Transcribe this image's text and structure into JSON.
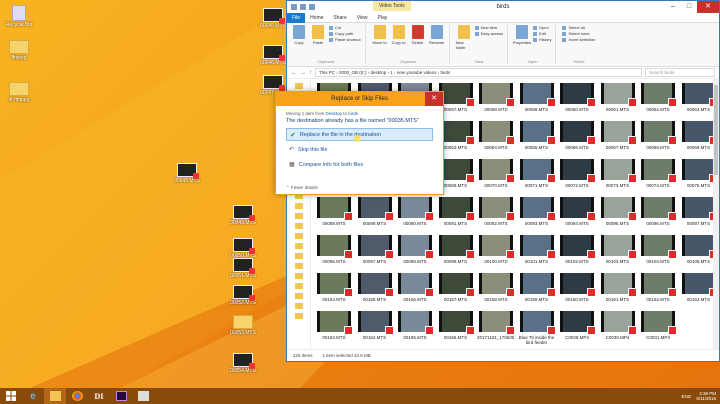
{
  "desktop": {
    "icons": [
      {
        "label": "Recycle Bin",
        "kind": "bin"
      },
      {
        "label": "ffmpeg",
        "kind": "folder"
      },
      {
        "label": "dl-ffmpeg",
        "kind": "app"
      },
      {
        "label": "00045.MTS",
        "kind": "video"
      },
      {
        "label": "00046.MTS",
        "kind": "video"
      },
      {
        "label": "00047.MTS",
        "kind": "video"
      },
      {
        "label": "00048.MTS",
        "kind": "video"
      },
      {
        "label": "00049.MTS",
        "kind": "video"
      },
      {
        "label": "00050.MTS",
        "kind": "video"
      },
      {
        "label": "00051.MTS",
        "kind": "video"
      },
      {
        "label": "00052.MTS",
        "kind": "video"
      },
      {
        "label": "00053.MTS",
        "kind": "folder"
      },
      {
        "label": "00054.MTS",
        "kind": "video"
      }
    ]
  },
  "explorer": {
    "title": "birds",
    "context_tab": "Video Tools",
    "tabs": [
      "File",
      "Home",
      "Share",
      "View",
      "Play"
    ],
    "window_controls": {
      "minimize": "–",
      "maximize": "□",
      "close": "✕"
    },
    "ribbon": {
      "clipboard": {
        "label": "Clipboard",
        "copy": "Copy",
        "paste": "Paste",
        "cut": "Cut",
        "copy_path": "Copy path",
        "paste_shortcut": "Paste shortcut"
      },
      "organize": {
        "label": "Organize",
        "move_to": "Move to",
        "copy_to": "Copy to",
        "delete": "Delete",
        "rename": "Rename"
      },
      "new": {
        "label": "New",
        "new_folder": "New folder",
        "new_item": "New item",
        "easy_access": "Easy access"
      },
      "open": {
        "label": "Open",
        "properties": "Properties",
        "open": "Open",
        "edit": "Edit",
        "history": "History"
      },
      "select": {
        "label": "Select",
        "select_all": "Select all",
        "select_none": "Select none",
        "invert": "Invert selection"
      }
    },
    "address": "This PC  ›  2000_GB (E:)  ›  desktop  ›  1  ›  new youtube videos  ›  birds",
    "search_placeholder": "Search birds",
    "status": {
      "count": "225 items",
      "selection": "1 item selected  32.6 MB"
    },
    "files": [
      {
        "name": "00054.MTS"
      },
      {
        "name": "00055.MTS"
      },
      {
        "name": "00056.MTS"
      },
      {
        "name": "00057.MTS"
      },
      {
        "name": "00058.MTS"
      },
      {
        "name": "00059.MTS"
      },
      {
        "name": "00060.MTS"
      },
      {
        "name": "00061.MTS"
      },
      {
        "name": "00062.MTS"
      },
      {
        "name": "00063.MTS"
      },
      {
        "name": "00060.MTS"
      },
      {
        "name": "00061.MTS"
      },
      {
        "name": "00062.MTS"
      },
      {
        "name": "00063.MTS"
      },
      {
        "name": "00064.MTS"
      },
      {
        "name": "00065.MTS"
      },
      {
        "name": "00066.MTS"
      },
      {
        "name": "00067.MTS"
      },
      {
        "name": "00068.MTS"
      },
      {
        "name": "00069.MTS"
      },
      {
        "name": "00066.MTS"
      },
      {
        "name": "00067.MTS"
      },
      {
        "name": "00068.MTS"
      },
      {
        "name": "00069.MTS"
      },
      {
        "name": "00070.MTS"
      },
      {
        "name": "00071.MTS"
      },
      {
        "name": "00072.MTS"
      },
      {
        "name": "00073.MTS"
      },
      {
        "name": "00074.MTS"
      },
      {
        "name": "00075.MTS"
      },
      {
        "name": "00088.MTS"
      },
      {
        "name": "00089.MTS"
      },
      {
        "name": "00090.MTS"
      },
      {
        "name": "00091.MTS"
      },
      {
        "name": "00092.MTS"
      },
      {
        "name": "00093.MTS"
      },
      {
        "name": "00094.MTS"
      },
      {
        "name": "00095.MTS"
      },
      {
        "name": "00096.MTS"
      },
      {
        "name": "00097.MTS"
      },
      {
        "name": "00096.MTS"
      },
      {
        "name": "00097.MTS"
      },
      {
        "name": "00098.MTS"
      },
      {
        "name": "00099.MTS"
      },
      {
        "name": "00100.MTS"
      },
      {
        "name": "00101.MTS"
      },
      {
        "name": "00102.MTS"
      },
      {
        "name": "00103.MTS"
      },
      {
        "name": "00104.MTS"
      },
      {
        "name": "00105.MTS"
      },
      {
        "name": "00154.MTS"
      },
      {
        "name": "00155.MTS"
      },
      {
        "name": "00156.MTS"
      },
      {
        "name": "00157.MTS"
      },
      {
        "name": "00158.MTS"
      },
      {
        "name": "00159.MTS"
      },
      {
        "name": "00160.MTS"
      },
      {
        "name": "00161.MTS"
      },
      {
        "name": "00162.MTS"
      },
      {
        "name": "00163.MTS"
      },
      {
        "name": "00163.MTS"
      },
      {
        "name": "00164.MTS"
      },
      {
        "name": "00165.MTS"
      },
      {
        "name": "00166.MTS"
      },
      {
        "name": "20171104_170630.mp4"
      },
      {
        "name": "Blue Tit inside the bird feeder"
      },
      {
        "name": "C0029.MP4"
      },
      {
        "name": "C0030.MP4"
      },
      {
        "name": "C0031.MP4"
      },
      {
        "name": "EN: Chaffinch"
      },
      {
        "name": "eco coappok.MTS"
      },
      {
        "name": "Păsările Românie"
      },
      {
        "name": "00034 (2).MTS"
      }
    ]
  },
  "dialog": {
    "title": "Replace or Skip Files",
    "close": "✕",
    "moving_prefix": "Moving 1 item from ",
    "moving_from": "Desktop",
    "moving_mid": " to ",
    "moving_to": "birds",
    "message": "The destination already has a file named \"00035.MTS\"",
    "options": {
      "replace": "Replace the file in the destination",
      "skip": "Skip this file",
      "compare": "Compare info for both files"
    },
    "fewer_details": "Fewer details"
  },
  "taskbar": {
    "apps": [
      "Start",
      "Internet Explorer",
      "File Explorer",
      "Chrome",
      "DI",
      "Premiere",
      "Save"
    ],
    "lang": "ENG",
    "time": "4:36 PM",
    "date": "5/11/2018"
  }
}
